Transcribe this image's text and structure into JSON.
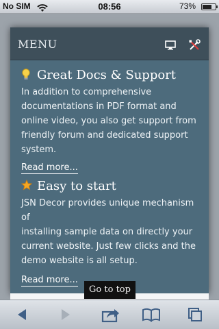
{
  "status": {
    "carrier": "No SIM",
    "time": "08:56",
    "battery": "73%",
    "battery_level": 0.73
  },
  "menu": {
    "label": "MENU",
    "icons": [
      "desktop-icon",
      "tools-icon"
    ]
  },
  "sections": [
    {
      "icon": "lightbulb-icon",
      "title": "Great Docs & Support",
      "body_lines": [
        "In addition to comprehensive",
        "documentations in PDF format and",
        "online video, you also get support from",
        "friendly forum and dedicated support",
        "system."
      ],
      "read_more": "Read more..."
    },
    {
      "icon": "star-icon",
      "title": "Easy to start",
      "body_lines": [
        "JSN Decor provides unique mechanism of",
        "installing sample data on directly your",
        "current website. Just few clicks and the",
        "demo website is all setup."
      ],
      "read_more": "Read more..."
    }
  ],
  "go_to_top": "Go to top",
  "toolbar": {
    "icons": [
      "back-icon",
      "forward-icon",
      "share-icon",
      "bookmarks-icon",
      "tabs-icon"
    ]
  }
}
